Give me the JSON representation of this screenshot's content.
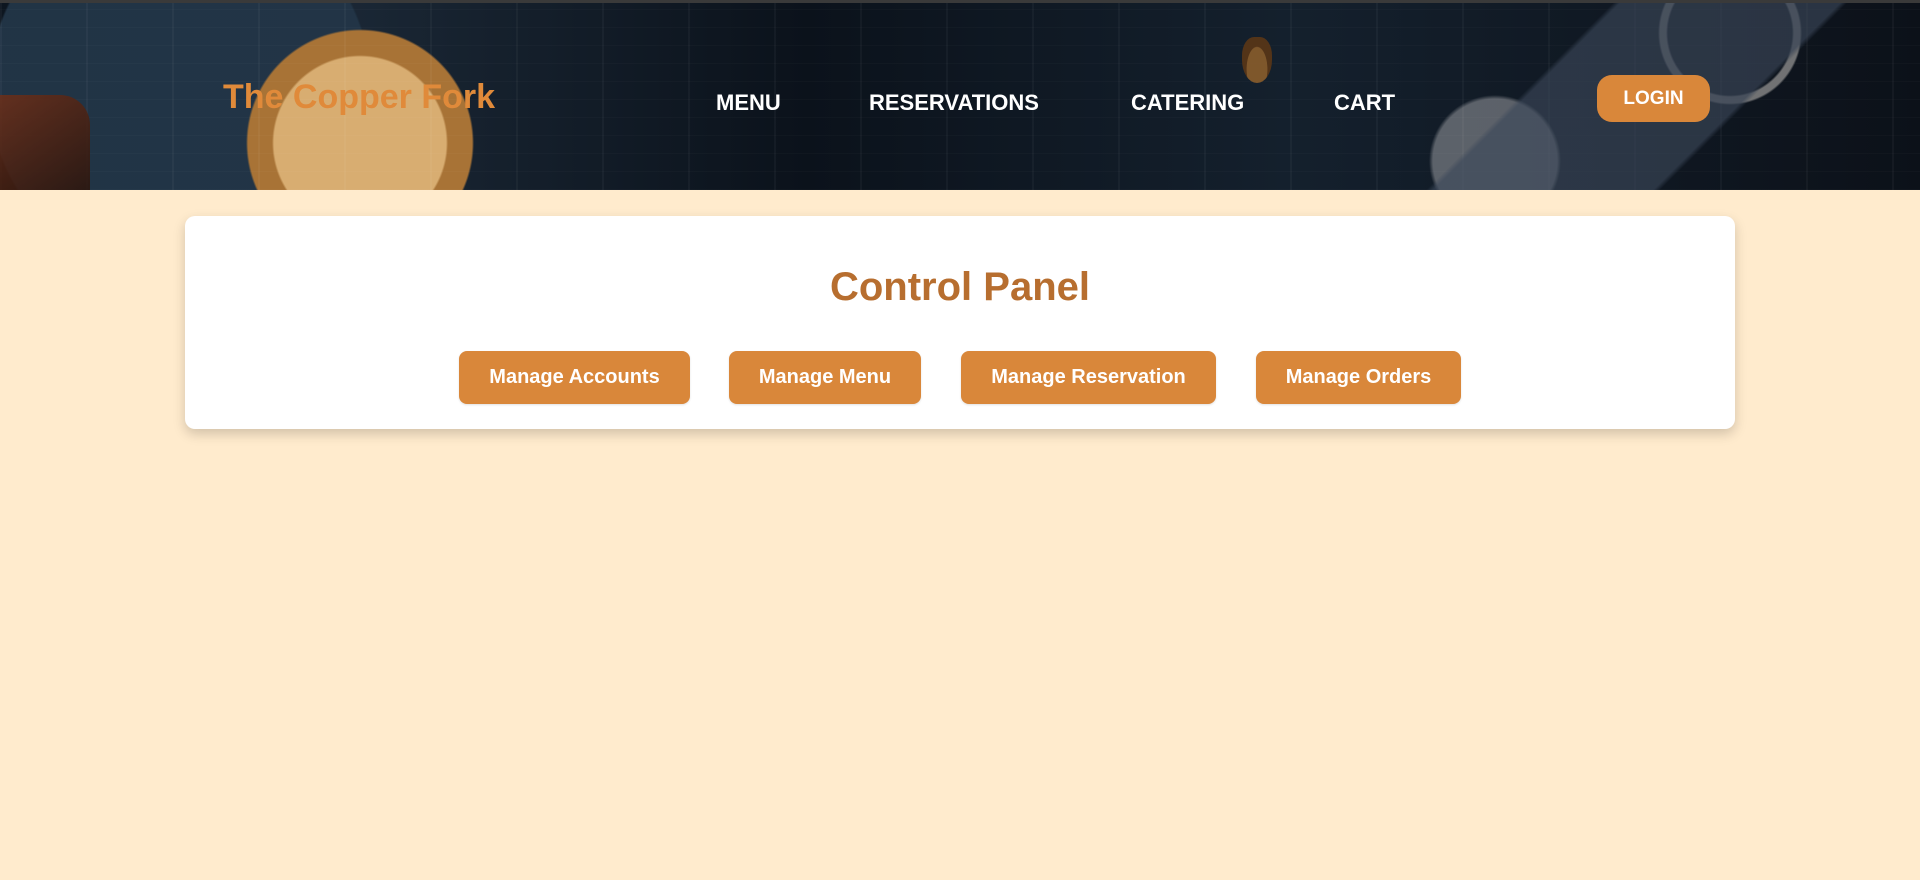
{
  "header": {
    "brand": "The Copper Fork",
    "nav": [
      {
        "label": "MENU"
      },
      {
        "label": "RESERVATIONS"
      },
      {
        "label": "CATERING"
      },
      {
        "label": "CART"
      }
    ],
    "login_label": "LOGIN"
  },
  "main": {
    "title": "Control Panel",
    "actions": [
      {
        "label": "Manage Accounts"
      },
      {
        "label": "Manage Menu"
      },
      {
        "label": "Manage Reservation"
      },
      {
        "label": "Manage Orders"
      }
    ]
  },
  "colors": {
    "page_background": "#FFEBCD",
    "accent": "#D9873A",
    "brand_text": "#E08A3A",
    "title_text": "#B76E2F",
    "card_background": "#FFFFFF"
  }
}
